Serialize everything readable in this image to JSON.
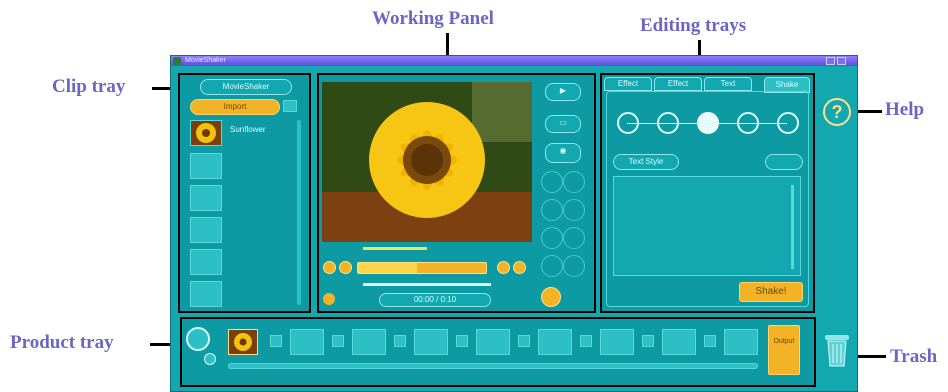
{
  "callouts": {
    "working_panel": "Working Panel",
    "editing_trays": "Editing trays",
    "clip_tray": "Clip tray",
    "help": "Help",
    "product_tray": "Product tray",
    "trash": "Trash"
  },
  "app": {
    "window_title": "MovieShaker"
  },
  "clip_tray": {
    "header": "MovieShaker",
    "import_label": "Import",
    "clip_name": "Sunflower"
  },
  "working_panel": {
    "time_readout": "00:00 / 0:10"
  },
  "editing_trays": {
    "tabs": [
      "Effect",
      "Effect",
      "Text",
      "Shake"
    ],
    "style_button": "Text Style",
    "shake_button": "Shake!"
  },
  "product_tray": {
    "output_label": "Output"
  },
  "colors": {
    "callout_text": "#6b66c4",
    "app_background": "#13a7b0",
    "accent_orange": "#f3b326",
    "titlebar": "#6a5ce0"
  },
  "icons": [
    "help-icon",
    "trash-icon",
    "import-icon",
    "play-icon",
    "scissors-icon",
    "camera-icon"
  ]
}
